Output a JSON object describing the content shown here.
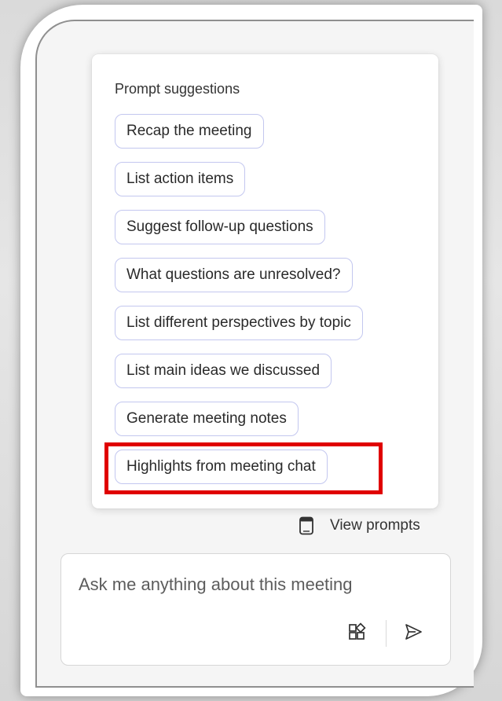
{
  "suggestions": {
    "title": "Prompt suggestions",
    "items": [
      {
        "label": "Recap the meeting"
      },
      {
        "label": "List action items"
      },
      {
        "label": "Suggest follow-up questions"
      },
      {
        "label": "What questions are unresolved?"
      },
      {
        "label": "List different perspectives by topic"
      },
      {
        "label": "List main ideas we discussed"
      },
      {
        "label": "Generate meeting notes"
      },
      {
        "label": "Highlights from meeting chat"
      }
    ],
    "highlighted_item": "Highlights from meeting chat",
    "highlight_color": "#e00000",
    "chip_border_color": "#c3c7ef"
  },
  "view_prompts": {
    "label": "View prompts",
    "icon": "prompt-book-icon"
  },
  "composer": {
    "placeholder": "Ask me anything about this meeting",
    "tools": [
      {
        "icon": "add-apps-icon"
      },
      {
        "icon": "send-icon"
      }
    ]
  }
}
